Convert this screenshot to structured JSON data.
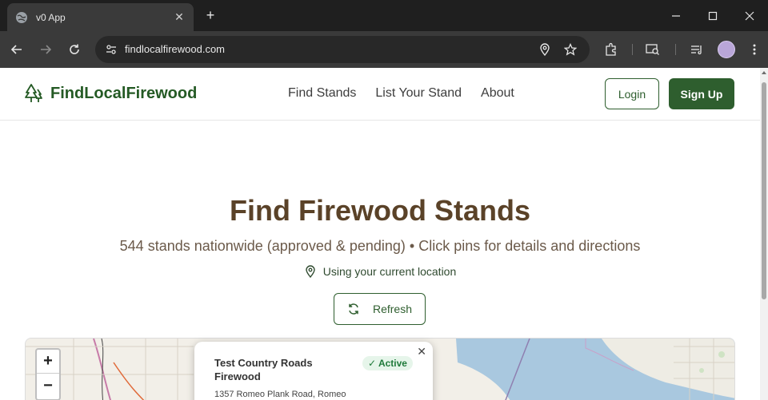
{
  "browser": {
    "tab_title": "v0 App",
    "tab_close": "✕",
    "new_tab": "+",
    "url": "findlocalfirewood.com"
  },
  "header": {
    "brand": "FindLocalFirewood",
    "nav": [
      "Find Stands",
      "List Your Stand",
      "About"
    ],
    "login": "Login",
    "signup": "Sign Up"
  },
  "hero": {
    "title": "Find Firewood Stands",
    "subtitle": "544 stands nationwide (approved & pending) • Click pins for details and directions",
    "location_text": "Using your current location",
    "refresh": "Refresh"
  },
  "map": {
    "zoom_in": "+",
    "zoom_out": "−",
    "popup": {
      "close": "✕",
      "name": "Test Country Roads Firewood",
      "status": "✓ Active",
      "address": "1357 Romeo Plank Road, Romeo"
    }
  },
  "colors": {
    "brand_green": "#2e5e2e",
    "title_brown": "#5a4228",
    "water": "#a9c8df"
  }
}
